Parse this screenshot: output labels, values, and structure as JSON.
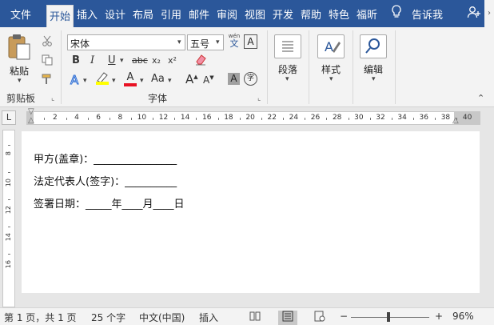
{
  "tabs": [
    "文件",
    "开始",
    "插入",
    "设计",
    "布局",
    "引用",
    "邮件",
    "审阅",
    "视图",
    "开发",
    "帮助",
    "特色",
    "福昕"
  ],
  "active_tab": "开始",
  "tell_me": "告诉我",
  "tell_me_icon": "lightbulb-icon",
  "share_icon": "share-person-icon",
  "ribbon": {
    "clipboard": {
      "paste_label": "粘贴",
      "group_label": "剪贴板"
    },
    "font": {
      "font_name": "宋体",
      "font_size": "五号",
      "pinyin_label": "wén",
      "pinyin_char": "文",
      "border_char": "A",
      "bold": "B",
      "italic": "I",
      "underline": "U",
      "strike": "abc",
      "subscript": "x₂",
      "superscript": "x²",
      "change_case": "Aa",
      "grow": "A",
      "shrink": "A",
      "shade_char": "A",
      "enclose_char": "字",
      "group_label": "字体"
    },
    "paragraph": {
      "label": "段落"
    },
    "styles": {
      "label": "样式"
    },
    "editing": {
      "label": "编辑"
    }
  },
  "ruler": {
    "numbers": [
      "2",
      "4",
      "6",
      "8",
      "10",
      "12",
      "14",
      "16",
      "18",
      "20",
      "22",
      "24",
      "26",
      "28",
      "30",
      "32",
      "34",
      "36",
      "38",
      "40"
    ],
    "vertical_numbers": [
      "8",
      "10",
      "12",
      "14",
      "16"
    ],
    "tab_selector": "L"
  },
  "document": {
    "lines": [
      "甲方(盖章)：________________",
      "法定代表人(签字)：__________",
      "签署日期：_____年____月____日"
    ]
  },
  "status": {
    "page": "第 1 页，共 1 页",
    "words": "25 个字",
    "language": "中文(中国)",
    "mode": "插入",
    "zoom_minus": "−",
    "zoom_plus": "+",
    "zoom": "96%",
    "zoom_value_percent": 96
  },
  "colors": {
    "title_bar": "#2b579a",
    "ribbon": "#f3f3f3",
    "highlight_yellow": "#ffff00",
    "font_red": "#e81123"
  }
}
